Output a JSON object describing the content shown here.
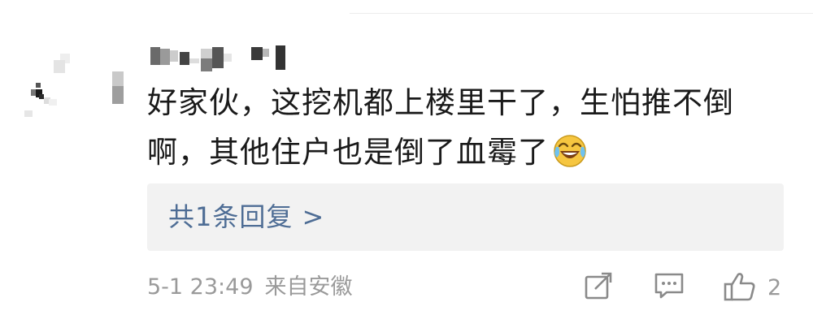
{
  "comment": {
    "text": "好家伙，这挖机都上楼里干了，生怕推不倒啊，其他住户也是倒了血霉了",
    "emoji": "laugh-cry-emoji"
  },
  "replies": {
    "label": "共1条回复 >"
  },
  "meta": {
    "timestamp": "5-1 23:49",
    "location": "来自安徽"
  },
  "actions": {
    "share_icon": "share-icon",
    "comment_icon": "comment-icon",
    "like_icon": "thumbs-up-icon",
    "like_count": "2"
  },
  "colors": {
    "link": "#4e6d95",
    "meta": "#9a9a9a",
    "reply_bg": "#f2f2f2",
    "text": "#1a1a1a"
  }
}
